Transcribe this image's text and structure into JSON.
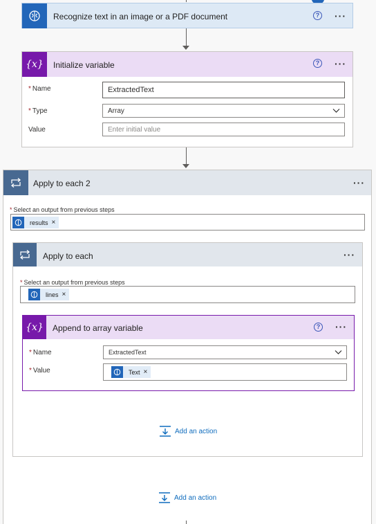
{
  "colors": {
    "accent_blue": "#2266b9",
    "variable_purple": "#7719aa",
    "loop_slate": "#486991",
    "link_blue": "#0f6cbd"
  },
  "steps": {
    "recognize": {
      "title": "Recognize text in an image or a PDF document",
      "icon": "ai-builder-brain-icon",
      "help": "?",
      "more": "···"
    },
    "init_var": {
      "title": "Initialize variable",
      "icon_label": "{x}",
      "help": "?",
      "more": "···",
      "name_label": "Name",
      "name_value": "ExtractedText",
      "type_label": "Type",
      "type_value": "Array",
      "value_label": "Value",
      "value_placeholder": "Enter initial value",
      "required_mark": "*"
    },
    "apply_each_2": {
      "title": "Apply to each 2",
      "icon": "loop-icon",
      "more": "···",
      "select_label": "Select an output from previous steps",
      "token": "results",
      "token_remove": "×",
      "add_action": "Add an action"
    },
    "apply_each": {
      "title": "Apply to each",
      "icon": "loop-icon",
      "more": "···",
      "select_label": "Select an output from previous steps",
      "token": "lines",
      "token_remove": "×",
      "add_action": "Add an action"
    },
    "append_var": {
      "title": "Append to array variable",
      "icon_label": "{x}",
      "help": "?",
      "more": "···",
      "name_label": "Name",
      "name_value": "ExtractedText",
      "value_label": "Value",
      "token": "Text",
      "token_remove": "×"
    }
  }
}
